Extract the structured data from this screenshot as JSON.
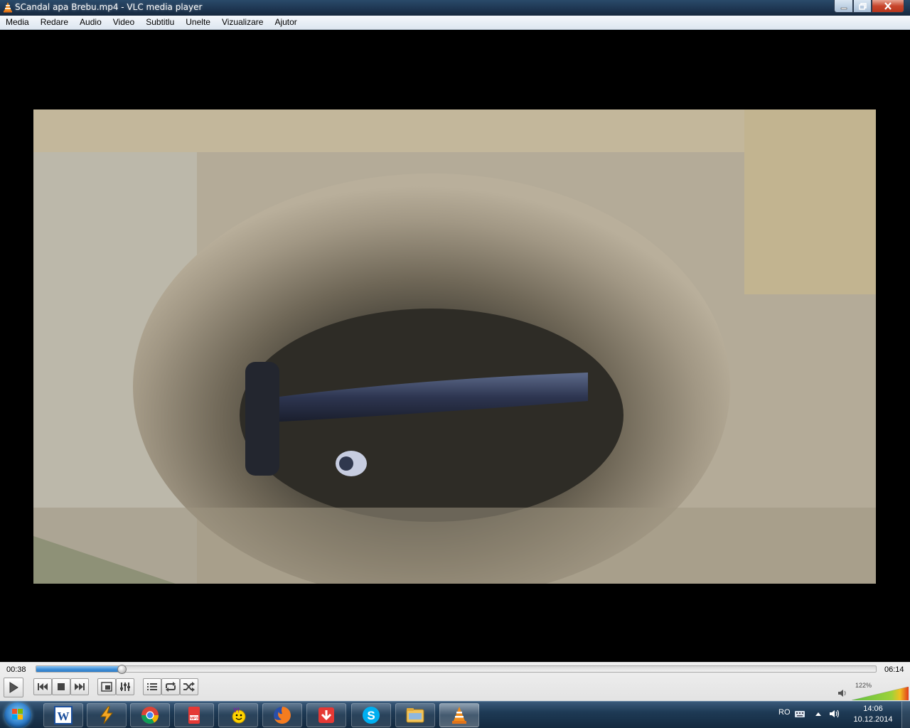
{
  "window": {
    "title": "SCandal apa Brebu.mp4 - VLC media player",
    "app_icon": "vlc-cone-icon"
  },
  "menu": [
    "Media",
    "Redare",
    "Audio",
    "Video",
    "Subtitlu",
    "Unelte",
    "Vizualizare",
    "Ajutor"
  ],
  "player": {
    "elapsed": "00:38",
    "total": "06:14",
    "progress_fraction": 0.102,
    "volume_percent": "122%",
    "volume_fraction": 1.0
  },
  "controls": [
    "play-icon",
    "previous-icon",
    "stop-icon",
    "next-icon",
    "fullscreen-icon",
    "extended-settings-icon",
    "playlist-icon",
    "loop-icon",
    "shuffle-icon"
  ],
  "taskbar": {
    "apps": [
      "word-icon",
      "winamp-icon",
      "chrome-icon",
      "mp3-converter-icon",
      "yahoo-messenger-icon",
      "firefox-icon",
      "download-icon",
      "skype-icon",
      "file-explorer-icon",
      "vlc-icon"
    ],
    "language": "RO",
    "time": "14:06",
    "date": "10.12.2014"
  },
  "colors": {
    "accent": "#3e8fd8",
    "vlc_orange": "#f28c1a"
  }
}
